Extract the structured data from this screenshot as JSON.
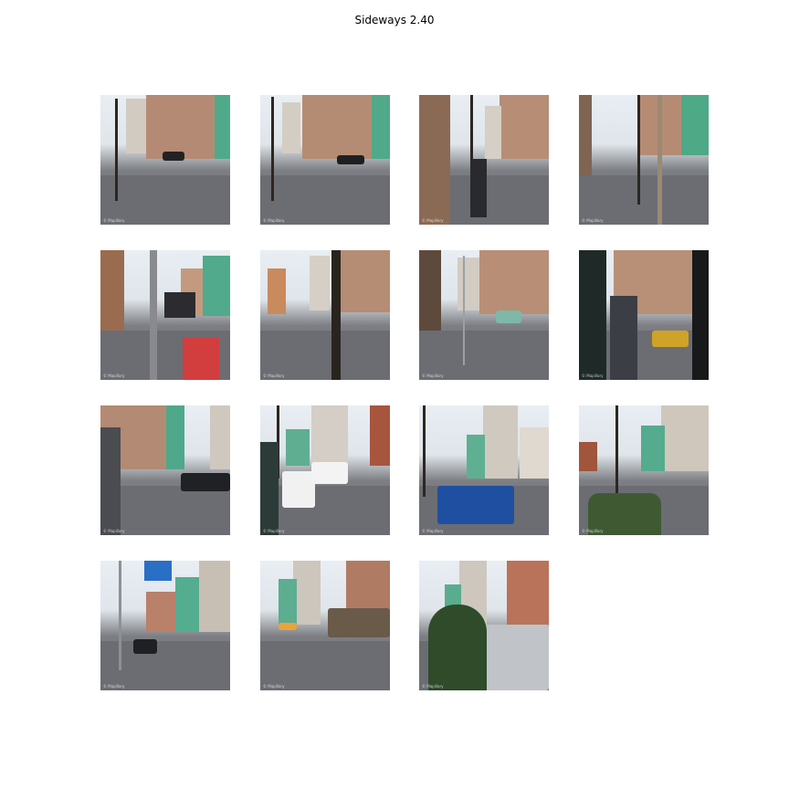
{
  "title": "Sideways 2.40",
  "tiles": [
    {
      "id": 1
    },
    {
      "id": 2
    },
    {
      "id": 3
    },
    {
      "id": 4
    },
    {
      "id": 5
    },
    {
      "id": 6
    },
    {
      "id": 7
    },
    {
      "id": 8
    },
    {
      "id": 9
    },
    {
      "id": 10
    },
    {
      "id": 11
    },
    {
      "id": 12
    },
    {
      "id": 13
    },
    {
      "id": 14
    },
    {
      "id": 15
    }
  ]
}
